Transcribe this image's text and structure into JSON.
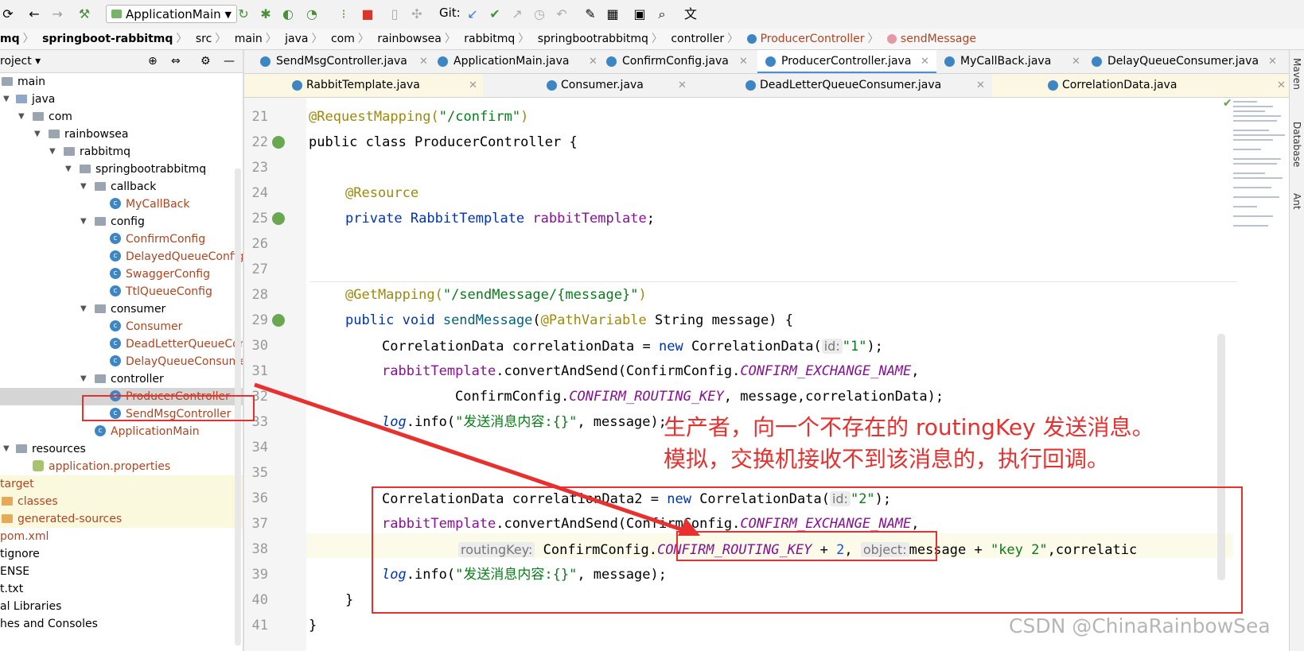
{
  "toolbar": {
    "run_config": "ApplicationMain",
    "git_label": "Git:",
    "icons": [
      "refresh-icon",
      "back-icon",
      "forward-icon",
      "build-hammer-icon",
      "run-icon",
      "debug-icon",
      "coverage-icon",
      "profile-icon",
      "build-icon",
      "stop-icon",
      "vcs-update-icon",
      "vcs-commit-icon",
      "vcs-push-icon",
      "history-icon",
      "rollback-icon",
      "settings-wrench-icon",
      "project-structure-icon",
      "terminal-icon",
      "search-icon",
      "translate-icon"
    ]
  },
  "breadcrumb": [
    "mq",
    "springboot-rabbitmq",
    "src",
    "main",
    "java",
    "com",
    "rainbowsea",
    "rabbitmq",
    "springbootrabbitmq",
    "controller",
    "ProducerController",
    "sendMessage"
  ],
  "project_panel": {
    "title": "roject",
    "tree": [
      {
        "label": "main",
        "kind": "folder",
        "level": 0
      },
      {
        "label": "java",
        "kind": "folder",
        "level": 1
      },
      {
        "label": "com",
        "kind": "folder",
        "level": 2
      },
      {
        "label": "rainbowsea",
        "kind": "folder",
        "level": 3
      },
      {
        "label": "rabbitmq",
        "kind": "folder",
        "level": 4
      },
      {
        "label": "springbootrabbitmq",
        "kind": "folder",
        "level": 5
      },
      {
        "label": "callback",
        "kind": "folder",
        "level": 6
      },
      {
        "label": "MyCallBack",
        "kind": "class",
        "level": 7
      },
      {
        "label": "config",
        "kind": "folder",
        "level": 6
      },
      {
        "label": "ConfirmConfig",
        "kind": "class",
        "level": 7
      },
      {
        "label": "DelayedQueueConfig",
        "kind": "class",
        "level": 7
      },
      {
        "label": "SwaggerConfig",
        "kind": "class",
        "level": 7
      },
      {
        "label": "TtlQueueConfig",
        "kind": "class",
        "level": 7
      },
      {
        "label": "consumer",
        "kind": "folder",
        "level": 6
      },
      {
        "label": "Consumer",
        "kind": "class",
        "level": 7
      },
      {
        "label": "DeadLetterQueueCon",
        "kind": "class",
        "level": 7
      },
      {
        "label": "DelayQueueConsumer",
        "kind": "class",
        "level": 7
      },
      {
        "label": "controller",
        "kind": "folder",
        "level": 6
      },
      {
        "label": "ProducerController",
        "kind": "class",
        "level": 7
      },
      {
        "label": "SendMsgController",
        "kind": "class",
        "level": 7
      },
      {
        "label": "ApplicationMain",
        "kind": "class",
        "level": 6
      },
      {
        "label": "resources",
        "kind": "folder",
        "level": 1
      },
      {
        "label": "application.properties",
        "kind": "file",
        "level": 2
      },
      {
        "label": "target",
        "kind": "plain",
        "level": 0
      },
      {
        "label": "classes",
        "kind": "folder-orange",
        "level": 0
      },
      {
        "label": "generated-sources",
        "kind": "folder-orange",
        "level": 0
      },
      {
        "label": "pom.xml",
        "kind": "plain",
        "level": 0
      },
      {
        "label": "tignore",
        "kind": "plain",
        "level": 0
      },
      {
        "label": "ENSE",
        "kind": "plain",
        "level": 0
      },
      {
        "label": "t.txt",
        "kind": "plain",
        "level": 0
      },
      {
        "label": "al Libraries",
        "kind": "plain",
        "level": 0
      },
      {
        "label": "hes and Consoles",
        "kind": "plain",
        "level": 0
      }
    ]
  },
  "tabs_row1": [
    "SendMsgController.java",
    "ApplicationMain.java",
    "ConfirmConfig.java",
    "ProducerController.java",
    "MyCallBack.java",
    "DelayQueueConsumer.java"
  ],
  "tabs_row2": [
    "RabbitTemplate.java",
    "Consumer.java",
    "DeadLetterQueueConsumer.java",
    "CorrelationData.java"
  ],
  "right_strip": [
    "Maven",
    "Database",
    "Ant"
  ],
  "code": {
    "line_numbers": [
      "21",
      "22",
      "23",
      "24",
      "25",
      "26",
      "27",
      "28",
      "29",
      "30",
      "31",
      "32",
      "33",
      "34",
      "35",
      "36",
      "37",
      "38",
      "39",
      "40",
      "41"
    ],
    "l21_ann": "@RequestMapping(",
    "l21_str": "\"/confirm\"",
    "l21_end": ")",
    "l22": "public class ProducerController {",
    "l24": "@Resource",
    "l25_a": "private RabbitTemplate ",
    "l25_b": "rabbitTemplate",
    "l25_c": ";",
    "l28_ann": "@GetMapping(",
    "l28_str": "\"/sendMessage/{message}\"",
    "l28_end": ")",
    "l29_a": "public void ",
    "l29_b": "sendMessage",
    "l29_c": "(",
    "l29_d": "@PathVariable",
    "l29_e": " String message) {",
    "l30_a": "CorrelationData correlationData = ",
    "l30_b": "new",
    "l30_c": " CorrelationData(",
    "l30_hint": "id:",
    "l30_str": "\"1\"",
    "l30_end": ");",
    "l31_a": "rabbitTemplate",
    "l31_b": ".convertAndSend(ConfirmConfig.",
    "l31_c": "CONFIRM_EXCHANGE_NAME",
    "l31_d": ",",
    "l32_a": "ConfirmConfig.",
    "l32_b": "CONFIRM_ROUTING_KEY",
    "l32_c": ", message,correlationData);",
    "l33_a": "log",
    "l33_b": ".info(",
    "l33_str": "\"发送消息内容:{}\"",
    "l33_c": ", message);",
    "l36_a": "CorrelationData correlationData2 = ",
    "l36_b": "new",
    "l36_c": " CorrelationData(",
    "l36_hint": "id:",
    "l36_str": "\"2\"",
    "l36_end": ");",
    "l37_a": "rabbitTemplate",
    "l37_b": ".convertAndSend(ConfirmConfig.",
    "l37_c": "CONFIRM_EXCHANGE_NAME",
    "l37_d": ",",
    "l38_hint1": "routingKey:",
    "l38_a": "ConfirmConfig.",
    "l38_b": "CONFIRM_ROUTING_KEY",
    "l38_c": " + ",
    "l38_num": "2",
    "l38_d": ",",
    "l38_hint2": "object:",
    "l38_e": "message + ",
    "l38_str": "\"key 2\"",
    "l38_f": ",correlatic",
    "l39_a": "log",
    "l39_b": ".info(",
    "l39_str": "\"发送消息内容:{}\"",
    "l39_c": ", message);",
    "l40": "}",
    "l41": "}"
  },
  "annotation": {
    "line1": "生产者，向一个不存在的 routingKey 发送消息。",
    "line2": "模拟，交换机接收不到该消息的，执行回调。",
    "color": "#e8302f"
  },
  "watermark": "CSDN @ChinaRainbowSea"
}
